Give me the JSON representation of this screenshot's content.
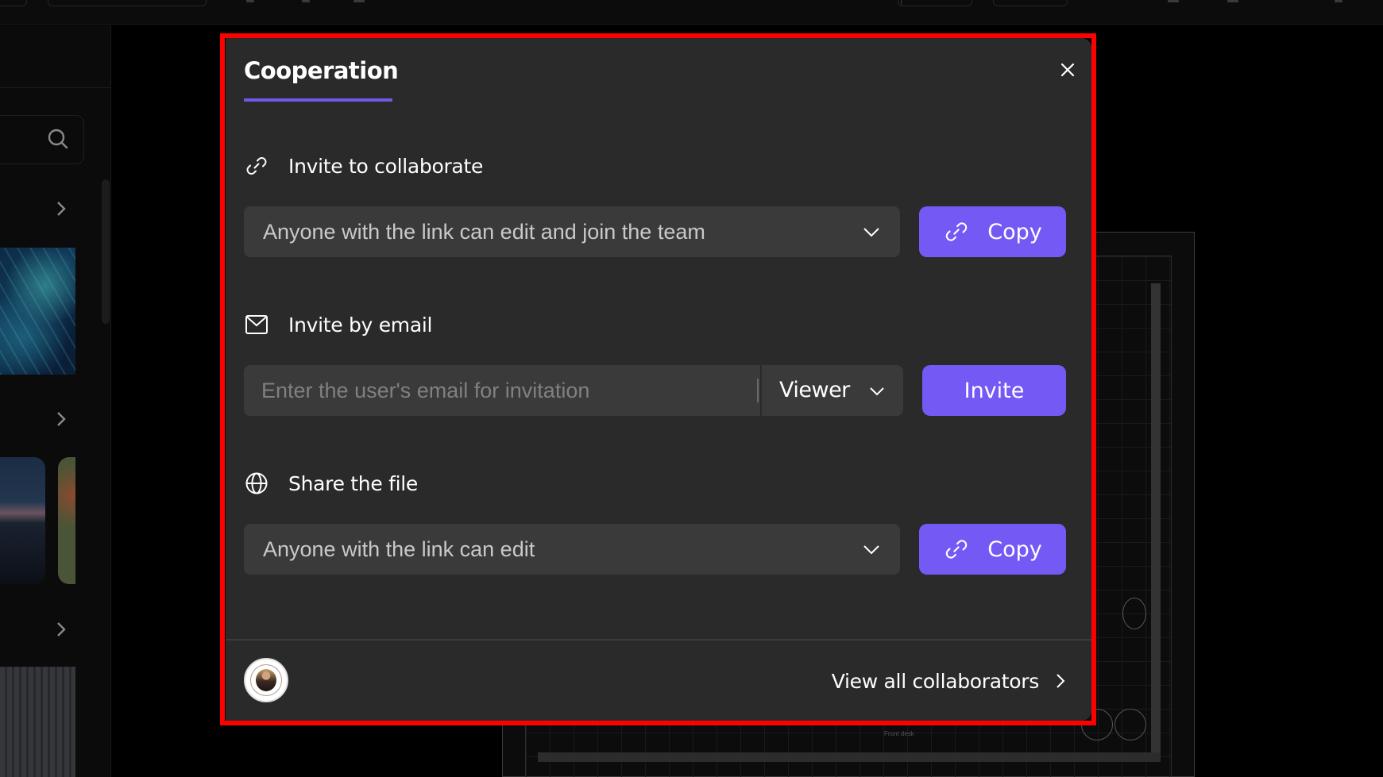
{
  "modal": {
    "title": "Cooperation",
    "close_icon": "close-icon",
    "sections": {
      "collaborate": {
        "icon": "link-icon",
        "heading": "Invite to collaborate",
        "permission_selected": "Anyone with the link can edit and join the team",
        "copy_label": "Copy"
      },
      "email": {
        "icon": "mail-icon",
        "heading": "Invite by email",
        "email_value": "",
        "email_placeholder": "Enter the user's email for invitation",
        "role_selected": "Viewer",
        "invite_label": "Invite"
      },
      "share": {
        "icon": "globe-icon",
        "heading": "Share the file",
        "permission_selected": "Anyone with the link can edit",
        "copy_label": "Copy"
      }
    },
    "footer": {
      "avatar": "user-avatar",
      "view_all_label": "View all collaborators"
    }
  },
  "colors": {
    "accent": "#7559f5",
    "title_underline": "#7258e8",
    "modal_bg": "#2a2a2a",
    "field_bg": "#3a3a3a",
    "highlight_border": "#ff0000"
  },
  "background": {
    "floor_plan_label": "Front desk"
  }
}
